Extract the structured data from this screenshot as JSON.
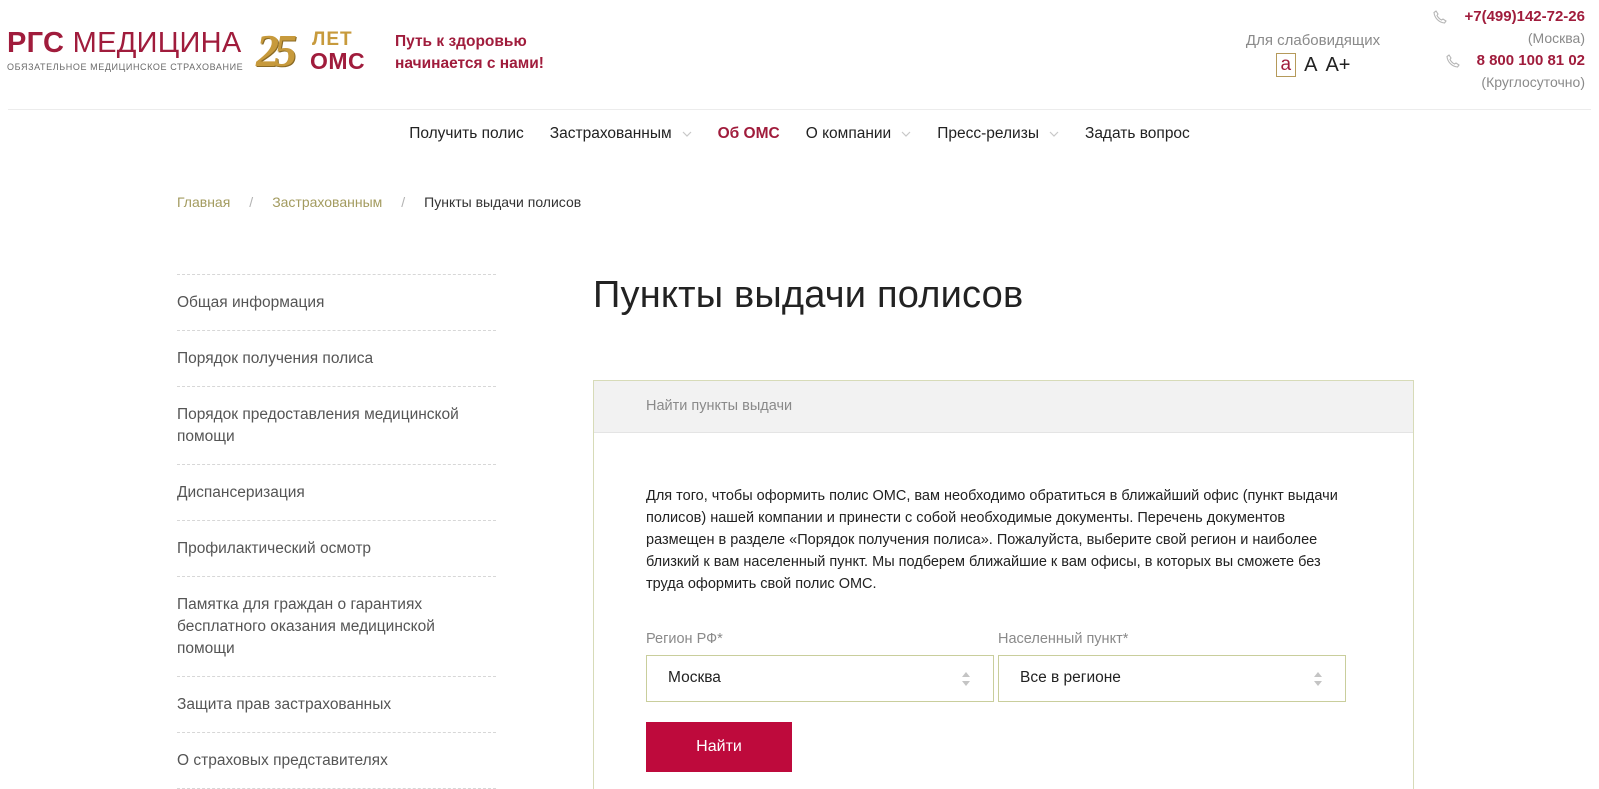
{
  "header": {
    "logo_bold": "РГС",
    "logo_text": " МЕДИЦИНА",
    "logo_sub": "ОБЯЗАТЕЛЬНОЕ МЕДИЦИНСКОЕ СТРАХОВАНИЕ",
    "anniversary": {
      "number": "25",
      "word1": "ЛЕТ",
      "word2": "ОМС"
    },
    "tagline_line1": "Путь к здоровью",
    "tagline_line2": "начинается с нами!",
    "vision": {
      "label": "Для слабовидящих",
      "size_small": "a",
      "size_medium": "A",
      "size_large": "A+"
    },
    "contacts": {
      "phone_moscow": "+7(499)142-72-26",
      "phone_moscow_note": "(Москва)",
      "phone_hotline": "8 800 100 81 02",
      "phone_hotline_note": "(Круглосуточно)"
    }
  },
  "nav": {
    "items": [
      {
        "label": "Получить полис"
      },
      {
        "label": "Застрахованным"
      },
      {
        "label": "Об ОМС"
      },
      {
        "label": "О компании"
      },
      {
        "label": "Пресс-релизы"
      },
      {
        "label": "Задать вопрос"
      }
    ]
  },
  "breadcrumb": {
    "home": "Главная",
    "section": "Застрахованным",
    "separator": "/",
    "current": "Пункты выдачи полисов"
  },
  "sidebar": {
    "items": [
      {
        "label": "Общая информация"
      },
      {
        "label": "Порядок получения полиса"
      },
      {
        "label": "Порядок предоставления медицинской помощи"
      },
      {
        "label": "Диспансеризация"
      },
      {
        "label": "Профилактический осмотр"
      },
      {
        "label": "Памятка для граждан о гарантиях бесплатного оказания медицинской помощи"
      },
      {
        "label": "Защита прав застрахованных"
      },
      {
        "label": "О страховых представителях"
      }
    ]
  },
  "main": {
    "title": "Пункты выдачи полисов",
    "panel": {
      "heading": "Найти пункты выдачи",
      "description": "Для того, чтобы оформить полис ОМС, вам необходимо обратиться в ближайший офис (пункт выдачи полисов) нашей компании и принести с собой необходимые документы. Перечень документов размещен в разделе «Порядок получения полиса». Пожалуйста, выберите свой регион и наиболее близкий к вам населенный пункт. Мы подберем ближайшие к вам офисы, в которых вы сможете без труда оформить свой полис ОМС.",
      "region_label": "Регион РФ*",
      "region_value": "Москва",
      "city_label": "Населенный пункт*",
      "city_value": "Все в регионе",
      "submit_label": "Найти"
    }
  },
  "colors": {
    "brand": "#a01c3c",
    "button": "#be0a3c",
    "link_olive": "#a39b5f",
    "gold": "#c79a3c"
  }
}
